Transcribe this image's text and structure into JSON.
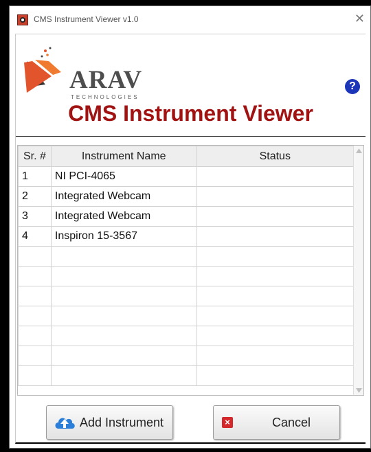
{
  "window": {
    "title": "CMS Instrument Viewer v1.0",
    "close_glyph": "✕"
  },
  "logo": {
    "name": "ARAV",
    "tagline": "TECHNOLOGIES"
  },
  "help_glyph": "?",
  "heading": "CMS Instrument Viewer",
  "table": {
    "headers": [
      "Sr. #",
      "Instrument Name",
      "Status"
    ],
    "rows": [
      [
        "1",
        "NI PCI-4065",
        ""
      ],
      [
        "2",
        "Integrated Webcam",
        ""
      ],
      [
        "3",
        "Integrated Webcam",
        ""
      ],
      [
        "4",
        "Inspiron 15-3567",
        ""
      ],
      [
        "",
        "",
        ""
      ],
      [
        "",
        "",
        ""
      ],
      [
        "",
        "",
        ""
      ],
      [
        "",
        "",
        ""
      ],
      [
        "",
        "",
        ""
      ],
      [
        "",
        "",
        ""
      ],
      [
        "",
        "",
        ""
      ]
    ]
  },
  "buttons": {
    "add_label": "Add Instrument",
    "cancel_label": "Cancel",
    "cancel_glyph": "×"
  },
  "colors": {
    "heading": "#a11212",
    "help": "#1b36b8",
    "cancel_icon": "#d3282c",
    "cloud": "#2b7fd8"
  }
}
